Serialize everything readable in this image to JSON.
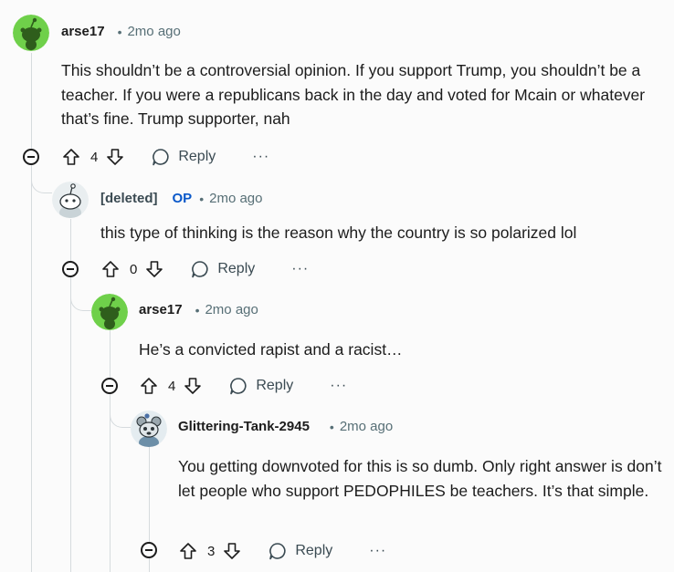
{
  "comments": [
    {
      "username": "arse17",
      "time": "2mo ago",
      "body": "This shouldn’t be a controversial opinion. If you support Trump, you shouldn’t be a teacher. If you were a republicans back in the day and voted for Mcain or whatever that’s fine. Trump supporter, nah",
      "score": "4",
      "reply_label": "Reply",
      "more_label": "···",
      "avatar": "snoo-green-avatar"
    },
    {
      "username": "[deleted]",
      "op_badge": "OP",
      "time": "2mo ago",
      "body": "this type of thinking is the reason why the country is so polarized lol",
      "score": "0",
      "reply_label": "Reply",
      "more_label": "···",
      "avatar": "deleted-user-avatar"
    },
    {
      "username": "arse17",
      "time": "2mo ago",
      "body": "He’s a convicted rapist and a racist…",
      "score": "4",
      "reply_label": "Reply",
      "more_label": "···",
      "avatar": "snoo-green-avatar"
    },
    {
      "username": "Glittering-Tank-2945",
      "time": "2mo ago",
      "body": "You getting downvoted for this is so dumb. Only right answer is don’t let people who support PEDOPHILES be teachers. It’s that simple.",
      "score": "3",
      "reply_label": "Reply",
      "more_label": "···",
      "avatar": "snoo-custom-avatar"
    }
  ],
  "dot_separator": "•",
  "colors": {
    "background": "#fbfbfb",
    "meta": "#576f76",
    "op": "#0a58c9",
    "snoo_green": "#6fd04a",
    "thread_line": "#d6dbde"
  }
}
